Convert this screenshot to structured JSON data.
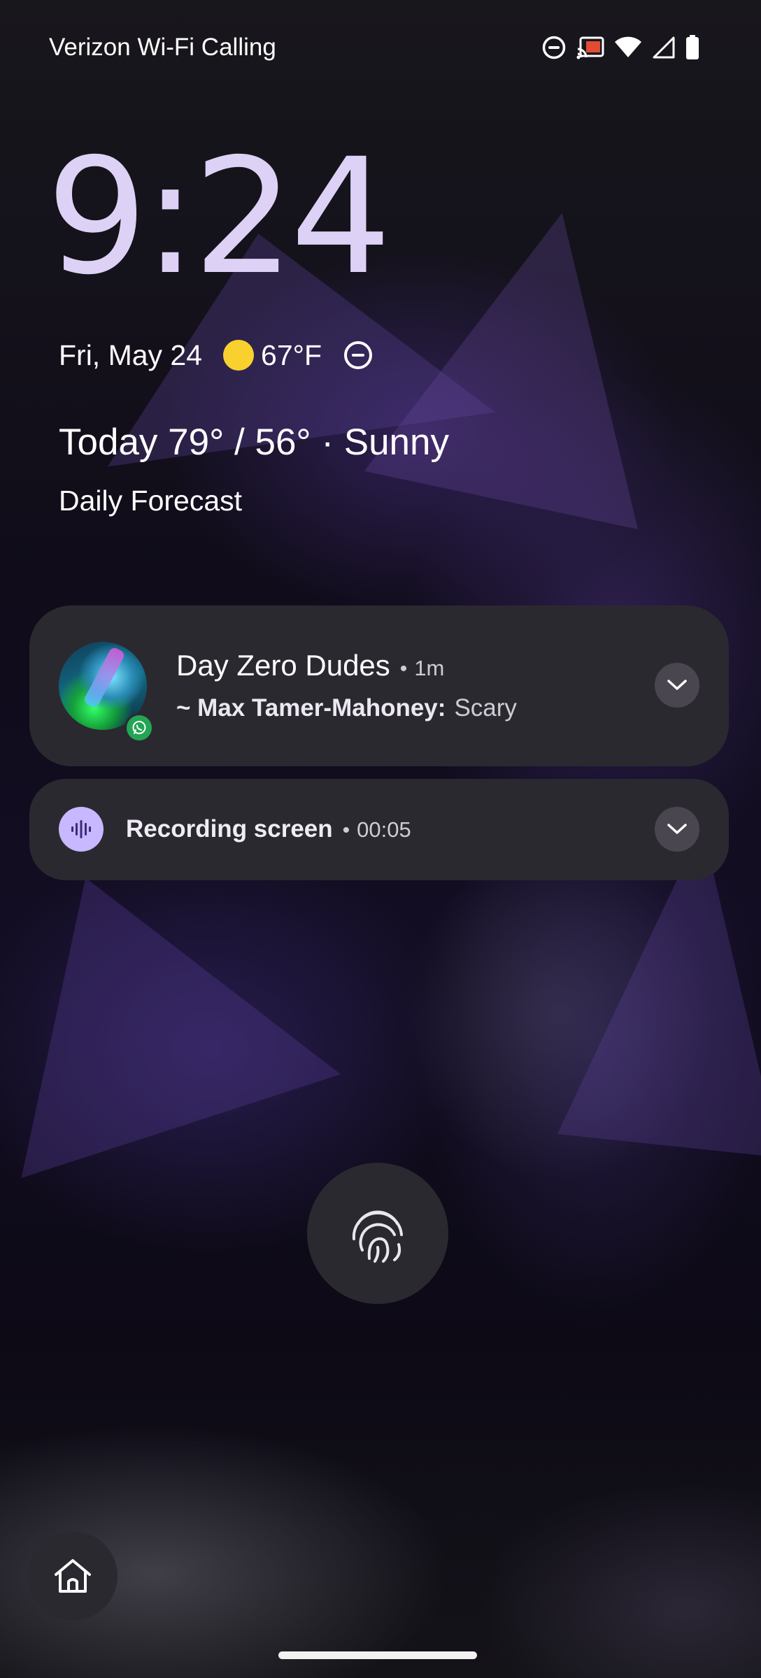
{
  "status_bar": {
    "carrier": "Verizon Wi-Fi Calling",
    "icons": [
      "do-not-disturb-icon",
      "cast-icon",
      "wifi-icon",
      "cell-signal-icon",
      "battery-icon"
    ]
  },
  "lockscreen": {
    "time": "9:24",
    "date": "Fri, May 24",
    "temperature": "67°F",
    "weather_summary": "Today 79° / 56° · Sunny",
    "forecast_link": "Daily Forecast"
  },
  "notifications": [
    {
      "app": "WhatsApp",
      "title": "Day Zero Dudes",
      "separator": "•",
      "time": "1m",
      "sender": "~ Max Tamer-Mahoney:",
      "message": "Scary"
    },
    {
      "title": "Recording screen",
      "separator": "•",
      "elapsed": "00:05"
    }
  ],
  "colors": {
    "clock": "#ddd2f5",
    "card_background": "#2b2930",
    "sun": "#f8d12f",
    "recording_accent": "#c7b8ff",
    "whatsapp_green": "#23a554"
  }
}
